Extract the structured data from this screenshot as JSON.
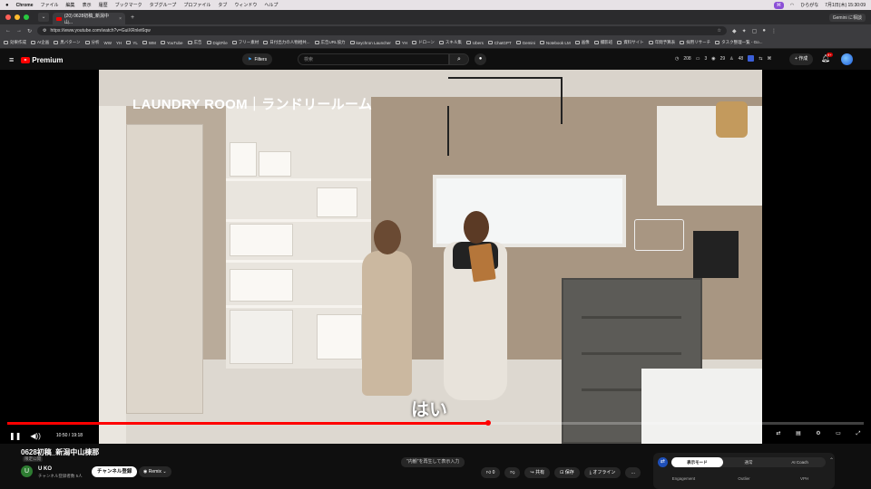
{
  "menubar": {
    "app": "Chrome",
    "items": [
      "ファイル",
      "編集",
      "表示",
      "履歴",
      "ブックマーク",
      "タブグループ",
      "プロファイル",
      "タブ",
      "ウィンドウ",
      "ヘルプ"
    ],
    "status": "ひらがな",
    "datetime": "7月1日(木) 15:30:09"
  },
  "browser": {
    "tab_title": "(20) 0628初稿_新潟中山...",
    "gemini_label": "Gemini に相談",
    "url": "https://www.youtube.com/watch?v=GuiXRnlet6qw",
    "bookmarks": [
      "効果作成",
      "AI企画",
      "黒バターン",
      "分析",
      "WW",
      "YH",
      "YL",
      "WM",
      "YouTube",
      "広告",
      "DigitFile",
      "フリー素材",
      "日付出力の人物相共...",
      "広告URL協力",
      "keychron Launcher",
      "YH",
      "ドローン",
      "スキル集",
      "Ubers",
      "ChatGPT",
      "Gemini",
      "Notebook LM",
      "画像",
      "撮影班",
      "資料サイト",
      "年間予算表",
      "採用リサーチ",
      "タスク整理一覧 - Go..."
    ]
  },
  "youtube": {
    "brand": "Premium",
    "filters_label": "Filters",
    "search_placeholder": "検索",
    "stats": [
      "208",
      "3",
      "29",
      "48"
    ],
    "create_label": "+ 作成",
    "notif_count": "9+"
  },
  "video": {
    "overlay_title": "LAUNDRY ROOM｜ランドリールーム",
    "caption": "はい",
    "current_time": "10:50",
    "duration": "19:18",
    "progress_fraction": 0.5617
  },
  "details": {
    "title": "0628初稿_新潟中山棟那",
    "visibility": "限定公開",
    "channel_initial": "U",
    "channel_name": "U KO",
    "subscribers": "チャンネル登録者数 5人",
    "subscribe_label": "チャンネル登録",
    "remix_label": "Remix",
    "hint": "\"内観\"を再生して表示入力",
    "like_count": "0",
    "share_label": "共有",
    "save_label": "保存",
    "offline_label": "オフライン",
    "more_label": "…"
  },
  "mode_panel": {
    "options": [
      "表示モード",
      "通常",
      "AI Coach"
    ],
    "active": "表示モード",
    "labels": [
      "Engagement",
      "Outlier",
      "VPH"
    ]
  }
}
